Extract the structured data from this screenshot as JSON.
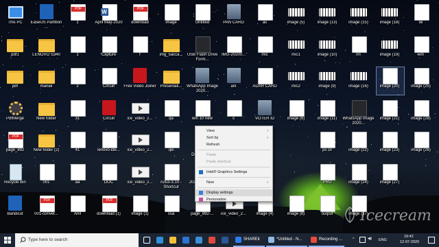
{
  "desktop": {
    "icons": [
      {
        "label": "This PC",
        "kind": "pc",
        "col": 0,
        "row": 0
      },
      {
        "label": "EaseUS Partition ...",
        "kind": "blue",
        "col": 1,
        "row": 0
      },
      {
        "label": "1",
        "kind": "pdf",
        "col": 2,
        "row": 0
      },
      {
        "label": "April May-2020",
        "kind": "word",
        "col": 3,
        "row": 0
      },
      {
        "label": "download",
        "kind": "pdf",
        "col": 4,
        "row": 0
      },
      {
        "label": "image",
        "kind": "file",
        "col": 5,
        "row": 0
      },
      {
        "label": "Untitled",
        "kind": "file",
        "col": 6,
        "row": 0
      },
      {
        "label": "PAN CARD",
        "kind": "photo",
        "col": 7,
        "row": 0
      },
      {
        "label": "as",
        "kind": "file",
        "col": 8,
        "row": 0
      },
      {
        "label": "image (5)",
        "kind": "barcode",
        "col": 9,
        "row": 0
      },
      {
        "label": "image (13)",
        "kind": "barcode",
        "col": 10,
        "row": 0
      },
      {
        "label": "image (15)",
        "kind": "barcode",
        "col": 11,
        "row": 0
      },
      {
        "label": "image (18)",
        "kind": "barcode",
        "col": 12,
        "row": 0
      },
      {
        "label": "wi",
        "kind": "file",
        "col": 13,
        "row": 0
      },
      {
        "label": "image (29)",
        "kind": "file",
        "col": 14,
        "row": 0
      },
      {
        "label": "pdf1",
        "kind": "folder",
        "col": 0,
        "row": 1
      },
      {
        "label": "LENOVO S340",
        "kind": "folder",
        "col": 1,
        "row": 1
      },
      {
        "label": "1",
        "kind": "file",
        "col": 2,
        "row": 1
      },
      {
        "label": "Capture",
        "kind": "file",
        "col": 3,
        "row": 1
      },
      {
        "label": "f",
        "kind": "file",
        "col": 4,
        "row": 1
      },
      {
        "label": "img_5acca...",
        "kind": "folder",
        "col": 5,
        "row": 1
      },
      {
        "label": "USB Flash Drive Form...",
        "kind": "dark",
        "col": 6,
        "row": 1
      },
      {
        "label": "IMG-20200...",
        "kind": "file",
        "col": 7,
        "row": 1
      },
      {
        "label": "mic",
        "kind": "file",
        "col": 8,
        "row": 1
      },
      {
        "label": "mic1",
        "kind": "barcode",
        "col": 9,
        "row": 1
      },
      {
        "label": "image (10)",
        "kind": "barcode",
        "col": 10,
        "row": 1
      },
      {
        "label": "nn",
        "kind": "file",
        "col": 11,
        "row": 1
      },
      {
        "label": "image (19)",
        "kind": "barcode",
        "col": 12,
        "row": 1
      },
      {
        "label": "win",
        "kind": "file",
        "col": 13,
        "row": 1
      },
      {
        "label": "ca",
        "kind": "file",
        "col": 14,
        "row": 1
      },
      {
        "label": "pdf",
        "kind": "folder",
        "col": 0,
        "row": 2
      },
      {
        "label": "manali",
        "kind": "folder",
        "col": 1,
        "row": 2
      },
      {
        "label": "2",
        "kind": "file",
        "col": 2,
        "row": 2
      },
      {
        "label": "Circuit",
        "kind": "file",
        "col": 3,
        "row": 2
      },
      {
        "label": "Free Video Joiner",
        "kind": "red",
        "col": 4,
        "row": 2
      },
      {
        "label": "Presentati...",
        "kind": "folder",
        "col": 5,
        "row": 2
      },
      {
        "label": "WhatsApp Image 2020...",
        "kind": "photo",
        "col": 6,
        "row": 2
      },
      {
        "label": "ani",
        "kind": "photo",
        "col": 7,
        "row": 2
      },
      {
        "label": "ADAR CARD",
        "kind": "file",
        "col": 8,
        "row": 2
      },
      {
        "label": "mic2",
        "kind": "barcode",
        "col": 9,
        "row": 2
      },
      {
        "label": "image (9)",
        "kind": "barcode",
        "col": 10,
        "row": 2
      },
      {
        "label": "image (16)",
        "kind": "barcode",
        "col": 11,
        "row": 2
      },
      {
        "label": "image (20)",
        "kind": "file",
        "col": 12,
        "row": 2,
        "selected": true
      },
      {
        "label": "image (25)",
        "kind": "file",
        "col": 13,
        "row": 2
      },
      {
        "label": "ice_video_2...",
        "kind": "file",
        "col": 14,
        "row": 2
      },
      {
        "label": "PdfMerge",
        "kind": "gear",
        "col": 0,
        "row": 3
      },
      {
        "label": "New folder",
        "kind": "folder",
        "col": 1,
        "row": 3
      },
      {
        "label": "31",
        "kind": "file",
        "col": 2,
        "row": 3
      },
      {
        "label": "Circuit",
        "kind": "red",
        "col": 3,
        "row": 3
      },
      {
        "label": "ice_video_2...",
        "kind": "video",
        "col": 4,
        "row": 3
      },
      {
        "label": "qa",
        "kind": "file",
        "col": 5,
        "row": 3
      },
      {
        "label": "win 10 new",
        "kind": "file",
        "col": 6,
        "row": 3
      },
      {
        "label": "s",
        "kind": "file",
        "col": 7,
        "row": 3
      },
      {
        "label": "VOTER ID",
        "kind": "photo",
        "col": 8,
        "row": 3
      },
      {
        "label": "image (6)",
        "kind": "file",
        "col": 9,
        "row": 3
      },
      {
        "label": "image (11)",
        "kind": "file",
        "col": 10,
        "row": 3
      },
      {
        "label": "WhatsApp Image 2020...",
        "kind": "dark",
        "col": 11,
        "row": 3
      },
      {
        "label": "image (21)",
        "kind": "file",
        "col": 12,
        "row": 3
      },
      {
        "label": "image (28)",
        "kind": "file",
        "col": 13,
        "row": 3
      },
      {
        "label": "camera",
        "kind": "file",
        "col": 14,
        "row": 3
      },
      {
        "label": "page_892",
        "kind": "pdf",
        "col": 0,
        "row": 4
      },
      {
        "label": "New folder (2)",
        "kind": "folder",
        "col": 1,
        "row": 4
      },
      {
        "label": "41",
        "kind": "file",
        "col": 2,
        "row": 4
      },
      {
        "label": "lenovo-ide...",
        "kind": "file",
        "col": 3,
        "row": 4
      },
      {
        "label": "ice_video_2...",
        "kind": "video",
        "col": 4,
        "row": 4
      },
      {
        "label": "qw",
        "kind": "file",
        "col": 5,
        "row": 4
      },
      {
        "label": "Youtube Download...",
        "kind": "red",
        "col": 6,
        "row": 4
      },
      {
        "label": "ddfs",
        "kind": "file",
        "col": 7,
        "row": 4
      },
      {
        "label": "ps Di",
        "kind": "file",
        "col": 10,
        "row": 4
      },
      {
        "label": "image (22)",
        "kind": "file",
        "col": 11,
        "row": 4
      },
      {
        "label": "image (23)",
        "kind": "file",
        "col": 12,
        "row": 4
      },
      {
        "label": "image (26)",
        "kind": "file",
        "col": 13,
        "row": 4
      },
      {
        "label": "Recycle Bin",
        "kind": "bin",
        "col": 0,
        "row": 5
      },
      {
        "label": "001",
        "kind": "file",
        "col": 1,
        "row": 5
      },
      {
        "label": "aa",
        "kind": "file",
        "col": 2,
        "row": 5
      },
      {
        "label": "DOC",
        "kind": "file",
        "col": 3,
        "row": 5
      },
      {
        "label": "ice_video_2...",
        "kind": "video",
        "col": 4,
        "row": 5
      },
      {
        "label": "rufus-3.10 - Shortcut",
        "kind": "file",
        "col": 5,
        "row": 5
      },
      {
        "label": "20200525_1...",
        "kind": "photo",
        "col": 6,
        "row": 5
      },
      {
        "label": "kb",
        "kind": "file",
        "col": 7,
        "row": 5
      },
      {
        "label": "PRO",
        "kind": "file",
        "col": 10,
        "row": 5
      },
      {
        "label": "image (24)",
        "kind": "file",
        "col": 11,
        "row": 5
      },
      {
        "label": "image (27)",
        "kind": "file",
        "col": 12,
        "row": 5
      },
      {
        "label": "Bandicut",
        "kind": "blue",
        "col": 0,
        "row": 6
      },
      {
        "label": "001-conver...",
        "kind": "pdf",
        "col": 1,
        "row": 6
      },
      {
        "label": "Anil",
        "kind": "file",
        "col": 2,
        "row": 6
      },
      {
        "label": "download (1)",
        "kind": "pdf",
        "col": 3,
        "row": 6
      },
      {
        "label": "image (1)",
        "kind": "file",
        "col": 4,
        "row": 6
      },
      {
        "label": "ssa",
        "kind": "file",
        "col": 5,
        "row": 6
      },
      {
        "label": "page_892-...",
        "kind": "file",
        "col": 6,
        "row": 6
      },
      {
        "label": "ice_video_2...",
        "kind": "video",
        "col": 7,
        "row": 6
      },
      {
        "label": "image (4)",
        "kind": "file",
        "col": 8,
        "row": 6
      },
      {
        "label": "image (8)",
        "kind": "file",
        "col": 9,
        "row": 6
      },
      {
        "label": "output",
        "kind": "file",
        "col": 10,
        "row": 6
      },
      {
        "label": "image (17)",
        "kind": "file",
        "col": 11,
        "row": 6
      }
    ]
  },
  "context_menu": {
    "items": [
      {
        "label": "View",
        "submenu": true
      },
      {
        "label": "Sort by",
        "submenu": true
      },
      {
        "label": "Refresh"
      },
      {
        "sep": true
      },
      {
        "label": "Paste",
        "disabled": true
      },
      {
        "label": "Paste shortcut",
        "disabled": true
      },
      {
        "sep": true
      },
      {
        "label": "Intel® Graphics Settings",
        "icon": "intel-graphics-icon"
      },
      {
        "sep": true
      },
      {
        "label": "New",
        "submenu": true
      },
      {
        "sep": true
      },
      {
        "label": "Display settings",
        "icon": "display-icon",
        "hover": true
      },
      {
        "label": "Personalize",
        "icon": "personalize-icon"
      }
    ]
  },
  "taskbar": {
    "search_placeholder": "Type here to search",
    "pinned": [
      {
        "name": "task-view-icon",
        "color": "#ffffff"
      },
      {
        "name": "edge-icon",
        "color": "#2f8fd6"
      },
      {
        "name": "file-explorer-icon",
        "color": "#f3c13a"
      },
      {
        "name": "mail-icon",
        "color": "#2b74d1"
      },
      {
        "name": "store-icon",
        "color": "#3d8fd9"
      },
      {
        "name": "chrome-icon",
        "color": "#e04a3a"
      },
      {
        "name": "word-icon",
        "color": "#2b5797"
      }
    ],
    "tasks": [
      {
        "name": "shareit-task",
        "label": "SHAREit",
        "color": "#2c7df0",
        "width": 46
      },
      {
        "name": "notepad-task",
        "label": "*Untitled - N...",
        "color": "#8fbbe3",
        "width": 60
      },
      {
        "name": "recording-task",
        "label": "Recording ...",
        "color": "#e74c3c",
        "width": 52
      }
    ],
    "tray": {
      "language": "ENG",
      "time": "19:42",
      "date": "12-07-2020"
    }
  },
  "watermark": {
    "text": "Icecream"
  }
}
